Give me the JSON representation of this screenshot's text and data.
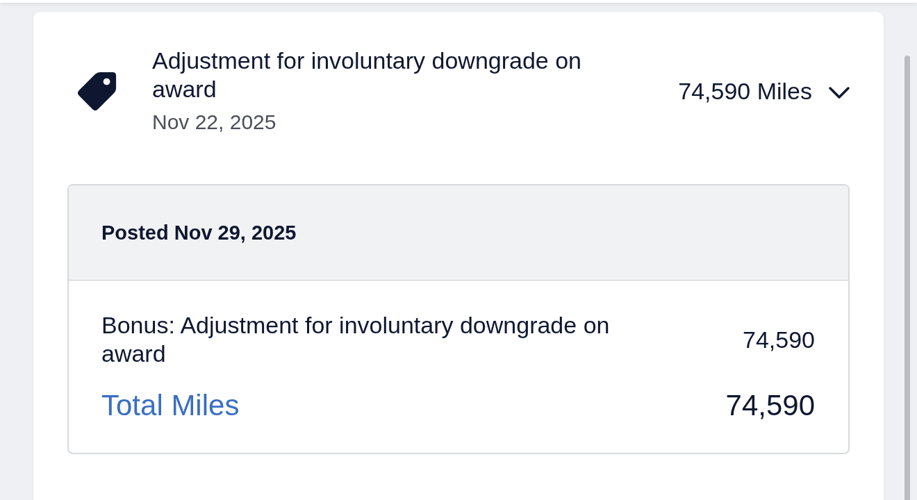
{
  "transaction": {
    "title": "Adjustment for involuntary downgrade on award",
    "date": "Nov 22, 2025",
    "amount": "74,590 Miles",
    "expanded": true,
    "details": {
      "posted": "Posted Nov 29, 2025",
      "lines": [
        {
          "label": "Bonus: Adjustment for involuntary downgrade on award",
          "value": "74,590"
        }
      ],
      "total": {
        "label": "Total Miles",
        "value": "74,590"
      }
    }
  }
}
